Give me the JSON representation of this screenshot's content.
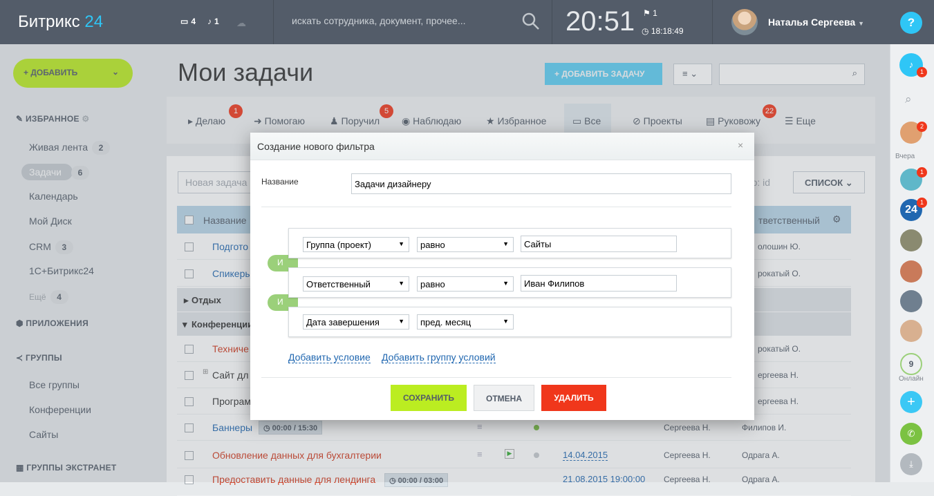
{
  "header": {
    "logo_main": "Битрикс",
    "logo_num": "24",
    "chat_count": "4",
    "notify_count": "1",
    "search_placeholder": "искать сотрудника, документ, прочее...",
    "clock": "20:51",
    "flag_count": "1",
    "timer": "18:18:49",
    "user": "Наталья Сергеева",
    "help": "?"
  },
  "left": {
    "add_label": "ДОБАВИТЬ",
    "fav": "ИЗБРАННОЕ",
    "items": [
      {
        "label": "Живая лента",
        "count": "2"
      },
      {
        "label": "Задачи",
        "count": "6"
      },
      {
        "label": "Календарь"
      },
      {
        "label": "Мой Диск"
      },
      {
        "label": "CRM",
        "count": "3"
      },
      {
        "label": "1С+Битрикс24"
      },
      {
        "label": "Ещё",
        "count": "4"
      }
    ],
    "apps": "ПРИЛОЖЕНИЯ",
    "groups": "ГРУППЫ",
    "group_items": [
      "Все группы",
      "Конференции",
      "Сайты"
    ],
    "extranet": "ГРУППЫ ЭКСТРАНЕТ"
  },
  "main": {
    "title": "Мои задачи",
    "add_task": "ДОБАВИТЬ ЗАДАЧУ",
    "tabs": [
      {
        "label": "Делаю",
        "badge": "1"
      },
      {
        "label": "Помогаю"
      },
      {
        "label": "Поручил",
        "badge": "5"
      },
      {
        "label": "Наблюдаю"
      },
      {
        "label": "Избранное"
      },
      {
        "label": "Все"
      },
      {
        "label": "Проекты"
      },
      {
        "label": "Руковожу",
        "badge": "22"
      },
      {
        "label": "Еще"
      }
    ],
    "new_task_placeholder": "Новая задача",
    "sort_label": "по: id",
    "list_btn": "СПИСОК",
    "col_name": "Название",
    "col_resp": "Ответственный"
  },
  "rows": {
    "r1": {
      "name": "Подгото",
      "resp": "олошин Ю."
    },
    "r2": {
      "name": "Спикеры",
      "resp": "рокатый О."
    },
    "g1": "Отдых",
    "g2": "Конференции",
    "r3": {
      "name": "Техниче",
      "resp": "рокатый О."
    },
    "r4": {
      "name": "Сайт дл",
      "resp": "ергеева Н."
    },
    "r5": {
      "name": "Програм",
      "resp": "ергеева Н."
    },
    "r6": {
      "name": "Баннеры",
      "timer": "00:00 / 15:30",
      "creator": "Сергеева Н.",
      "resp": "Филипов И."
    },
    "r7": {
      "name": "Обновление данных для бухгалтерии",
      "date": "14.04.2015",
      "creator": "Сергеева Н.",
      "resp": "Одрага А."
    },
    "r8": {
      "name": "Предоставить данные для лендинга",
      "timer": "00:00 / 03:00",
      "date": "21.08.2015 19:00:00",
      "creator": "Сергеева Н.",
      "resp": "Одрага А."
    }
  },
  "right": {
    "yesterday": "Вчера",
    "online_count": "9",
    "online": "Онлайн",
    "bell_badge": "1",
    "b2": "2",
    "b3": "1",
    "b4": "1"
  },
  "dialog": {
    "title": "Создание нового фильтра",
    "close": "×",
    "name_label": "Название",
    "name_value": "Задачи дизайнеру",
    "conditions": [
      {
        "field": "Группа (проект)",
        "op": "равно",
        "value": "Сайты"
      },
      {
        "field": "Ответственный",
        "op": "равно",
        "value": "Иван Филипов"
      },
      {
        "field": "Дата завершения",
        "op": "пред. месяц",
        "value": ""
      }
    ],
    "and_label": "И",
    "add_condition": "Добавить условие",
    "add_group": "Добавить группу условий",
    "save": "СОХРАНИТЬ",
    "cancel": "ОТМЕНА",
    "delete": "УДАЛИТЬ"
  },
  "colors": {
    "accent": "#2fc6f6",
    "add_green": "#bbed21",
    "save": "#bbed21",
    "delete": "#f0371b",
    "header": "#535c69"
  }
}
